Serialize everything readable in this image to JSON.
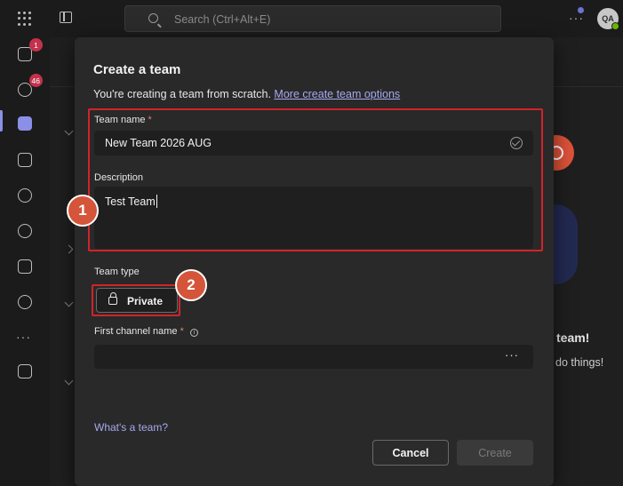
{
  "topbar": {
    "search_placeholder": "Search (Ctrl+Alt+E)",
    "more": "···",
    "avatar_initials": "QA"
  },
  "rail": {
    "activity_badge": "1",
    "chat_badge": "46",
    "more": "···"
  },
  "background": {
    "title_partial": "team!",
    "sub_partial": "do things!"
  },
  "dialog": {
    "title": "Create a team",
    "subtitle": "You're creating a team from scratch.",
    "subtitle_link": "More create team options",
    "team_name_label": "Team name",
    "required_mark": "*",
    "team_name_value": "New Team 2026 AUG",
    "description_label": "Description",
    "description_value": "Test Team",
    "team_type_label": "Team type",
    "team_type_value": "Private",
    "first_channel_label": "First channel name",
    "first_channel_value": "",
    "first_channel_more": "···",
    "help_link": "What's a team?",
    "cancel_label": "Cancel",
    "create_label": "Create"
  },
  "annotations": {
    "step1": "1",
    "step2": "2",
    "highlight_color": "#d2232a",
    "step_color": "#d4553a"
  },
  "colors": {
    "accent": "#8b8fe6",
    "link": "#a5a9f0",
    "badge": "#c4314b",
    "presence": "#6bb700"
  }
}
